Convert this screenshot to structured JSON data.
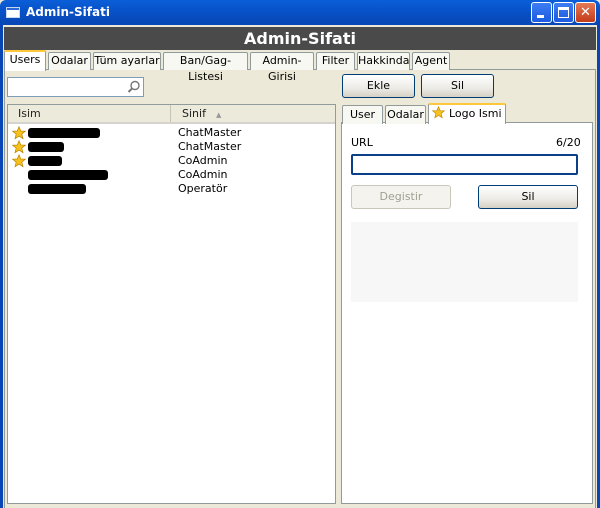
{
  "window": {
    "title": "Admin-Sifati",
    "header_title": "Admin-Sifati"
  },
  "tabs": [
    {
      "label": "Users",
      "active": true
    },
    {
      "label": "Odalar"
    },
    {
      "label": "Tüm ayarlar"
    },
    {
      "label": "Ban/Gag-Listesi"
    },
    {
      "label": "Admin-Girisi"
    },
    {
      "label": "Filter"
    },
    {
      "label": "Hakkinda"
    },
    {
      "label": "Agent"
    }
  ],
  "search": {
    "value": "",
    "placeholder": ""
  },
  "list": {
    "columns": [
      "Isim",
      "Sinif"
    ],
    "rows": [
      {
        "has_star": true,
        "class": "ChatMaster"
      },
      {
        "has_star": true,
        "class": "ChatMaster"
      },
      {
        "has_star": true,
        "class": "CoAdmin"
      },
      {
        "has_star": false,
        "class": "CoAdmin"
      },
      {
        "has_star": false,
        "class": "Operatör"
      }
    ]
  },
  "actions": {
    "add_label": "Ekle",
    "delete_label": "Sil"
  },
  "subtabs": [
    {
      "label": "User"
    },
    {
      "label": "Odalar"
    },
    {
      "label": "Logo Ismi",
      "active": true,
      "icon": "star-icon"
    }
  ],
  "logo_panel": {
    "url_label": "URL",
    "char_count": "6/20",
    "url_value": "",
    "change_label": "Degistir",
    "change_enabled": false,
    "delete_label": "Sil"
  },
  "colors": {
    "titlebar": "#0851c8",
    "header_band": "#4a4a4a",
    "active_tab_accent": "#ffc83c",
    "star": "#f7c21d"
  }
}
